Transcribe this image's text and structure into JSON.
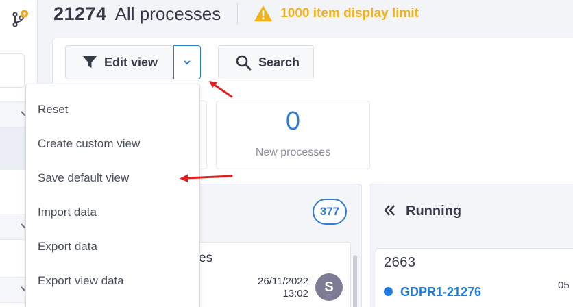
{
  "header": {
    "count": "21274",
    "title": "All processes",
    "warning": "1000 item display limit"
  },
  "toolbar": {
    "edit_view_label": "Edit view",
    "search_label": "Search"
  },
  "menu": {
    "items": [
      "Reset",
      "Create custom view",
      "Save default view",
      "Import data",
      "Export data",
      "Export view data"
    ]
  },
  "stats": {
    "new_processes_value": "0",
    "new_processes_label": "New processes"
  },
  "columns": {
    "left": {
      "badge": "377",
      "card": {
        "title_tail": "es",
        "date": "26/11/2022",
        "time": "13:02",
        "avatar_initial": "S"
      }
    },
    "right": {
      "title": "Running",
      "card": {
        "number": "2663",
        "link": "GDPR1-21276",
        "side_number": "05"
      }
    }
  },
  "colors": {
    "accent": "#2f7dd1",
    "warning": "#f2b21b",
    "annotation": "#e02020",
    "notification": "#f5a623"
  },
  "icons": {
    "branch": "git-branch-icon",
    "warning": "warning-triangle-icon",
    "filter": "filter-funnel-icon",
    "dropdown": "chevron-down-icon",
    "search": "search-magnifier-icon",
    "running": "double-chevron-left-icon"
  }
}
